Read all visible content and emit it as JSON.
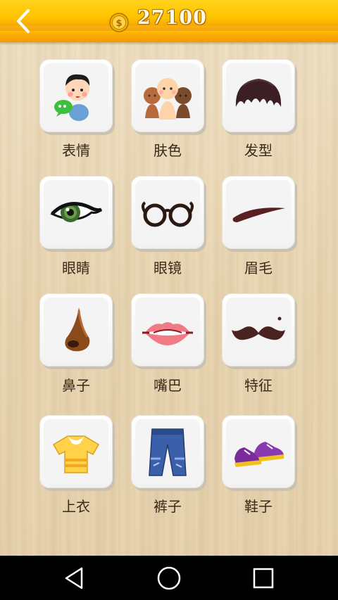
{
  "header": {
    "coins": "27100"
  },
  "categories": [
    {
      "label": "表情",
      "icon": "boy-face-icon"
    },
    {
      "label": "肤色",
      "icon": "skin-tones-icon"
    },
    {
      "label": "发型",
      "icon": "hairstyle-icon"
    },
    {
      "label": "眼睛",
      "icon": "eye-icon"
    },
    {
      "label": "眼镜",
      "icon": "glasses-icon"
    },
    {
      "label": "眉毛",
      "icon": "eyebrow-icon"
    },
    {
      "label": "鼻子",
      "icon": "nose-icon"
    },
    {
      "label": "嘴巴",
      "icon": "lips-icon"
    },
    {
      "label": "特征",
      "icon": "mustache-icon"
    },
    {
      "label": "上衣",
      "icon": "shirt-icon"
    },
    {
      "label": "裤子",
      "icon": "jeans-icon"
    },
    {
      "label": "鞋子",
      "icon": "sneakers-icon"
    }
  ],
  "colors": {
    "topbar": "#ffc400",
    "label_text": "#3a2a1a",
    "navbar": "#000000"
  }
}
